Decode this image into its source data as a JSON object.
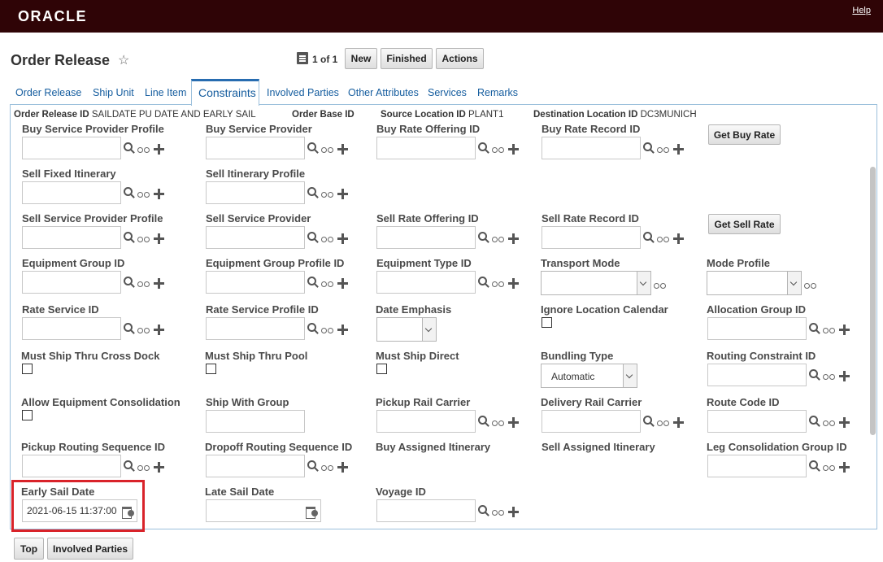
{
  "brand": {
    "logo": "ORACLE",
    "help": "Help"
  },
  "page": {
    "title": "Order Release",
    "record_count": "1 of 1"
  },
  "toolbar": {
    "new": "New",
    "finished": "Finished",
    "actions": "Actions"
  },
  "tabs": [
    "Order Release",
    "Ship Unit",
    "Line Item",
    "Constraints",
    "Involved Parties",
    "Other Attributes",
    "Services",
    "Remarks"
  ],
  "header": {
    "order_release_id_label": "Order Release ID",
    "order_release_id": "SAILDATE PU DATE AND EARLY SAIL",
    "order_base_id_label": "Order Base ID",
    "source_location_id_label": "Source Location ID",
    "source_location_id": "PLANT1",
    "destination_location_id_label": "Destination Location ID",
    "destination_location_id": "DC3MUNICH"
  },
  "fields": {
    "buy_sp_profile": "Buy Service Provider Profile",
    "buy_sp": "Buy Service Provider",
    "buy_rate_offering": "Buy Rate Offering ID",
    "buy_rate_record": "Buy Rate Record ID",
    "get_buy_rate": "Get Buy Rate",
    "sell_fixed_itin": "Sell Fixed Itinerary",
    "sell_itin_profile": "Sell Itinerary Profile",
    "sell_sp_profile": "Sell Service Provider Profile",
    "sell_sp": "Sell Service Provider",
    "sell_rate_offering": "Sell Rate Offering ID",
    "sell_rate_record": "Sell Rate Record ID",
    "get_sell_rate": "Get Sell Rate",
    "equip_group": "Equipment Group ID",
    "equip_group_profile": "Equipment Group Profile ID",
    "equip_type": "Equipment Type ID",
    "transport_mode": "Transport Mode",
    "mode_profile": "Mode Profile",
    "rate_service": "Rate Service ID",
    "rate_service_profile": "Rate Service Profile ID",
    "date_emphasis": "Date Emphasis",
    "ignore_loc_cal": "Ignore Location Calendar",
    "allocation_group": "Allocation Group ID",
    "must_ship_cross_dock": "Must Ship Thru Cross Dock",
    "must_ship_pool": "Must Ship Thru Pool",
    "must_ship_direct": "Must Ship Direct",
    "bundling_type": "Bundling Type",
    "bundling_value": "Automatic",
    "routing_constraint": "Routing Constraint ID",
    "allow_equip_consol": "Allow Equipment Consolidation",
    "ship_with_group": "Ship With Group",
    "pickup_rail": "Pickup Rail Carrier",
    "delivery_rail": "Delivery Rail Carrier",
    "route_code": "Route Code ID",
    "pickup_routing_seq": "Pickup Routing Sequence ID",
    "dropoff_routing_seq": "Dropoff Routing Sequence ID",
    "buy_assigned_itin": "Buy Assigned Itinerary",
    "sell_assigned_itin": "Sell Assigned Itinerary",
    "leg_consol_group": "Leg Consolidation Group ID",
    "early_sail_date": "Early Sail Date",
    "early_sail_value": "2021-06-15 11:37:00",
    "late_sail_date": "Late Sail Date",
    "voyage_id": "Voyage ID"
  },
  "footer": {
    "top": "Top",
    "involved_parties": "Involved Parties"
  },
  "colors": {
    "brand_bar": "#2f0406",
    "link": "#145c9e",
    "highlight": "#d9232a"
  }
}
